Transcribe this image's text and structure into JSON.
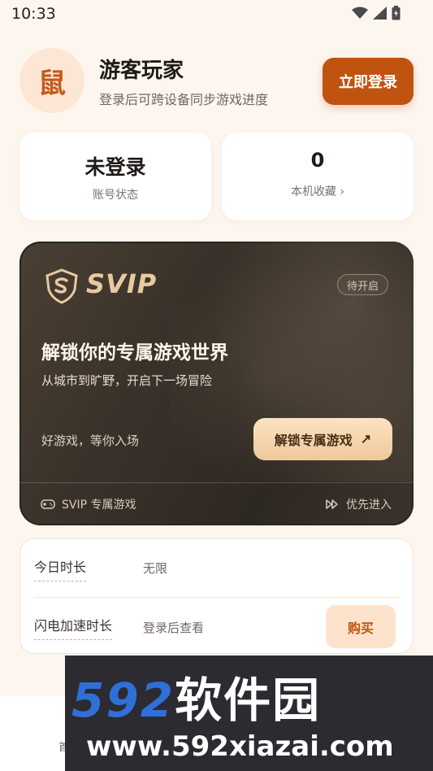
{
  "status_bar": {
    "time": "10:33"
  },
  "profile": {
    "avatar_glyph": "鼠",
    "name": "游客玩家",
    "subtitle": "登录后可跨设备同步游戏进度",
    "login_button": "立即登录"
  },
  "stats": {
    "account": {
      "value": "未登录",
      "label": "账号状态"
    },
    "favorites": {
      "value": "0",
      "label": "本机收藏 ›"
    }
  },
  "svip": {
    "brand": "SVIP",
    "status": "待开启",
    "title": "解锁你的专属游戏世界",
    "subtitle": "从城市到旷野，开启下一场冒险",
    "tagline": "好游戏，等你入场",
    "cta": "解锁专属游戏",
    "cta_arrow": "↗",
    "footer_left": "SVIP 专属游戏",
    "footer_right": "优先进入"
  },
  "duration": {
    "today_label": "今日时长",
    "today_value": "无限",
    "boost_label": "闪电加速时长",
    "boost_value": "登录后查看",
    "buy_button": "购买"
  },
  "bottom_nav": {
    "first_label": "首"
  },
  "watermark": {
    "title_digits": "592",
    "title_cn": "软件园",
    "url": "www.592xiazai.com"
  },
  "colors": {
    "accent": "#c0530f",
    "background": "#fdf6ef",
    "gold": "#e8c9a0"
  }
}
